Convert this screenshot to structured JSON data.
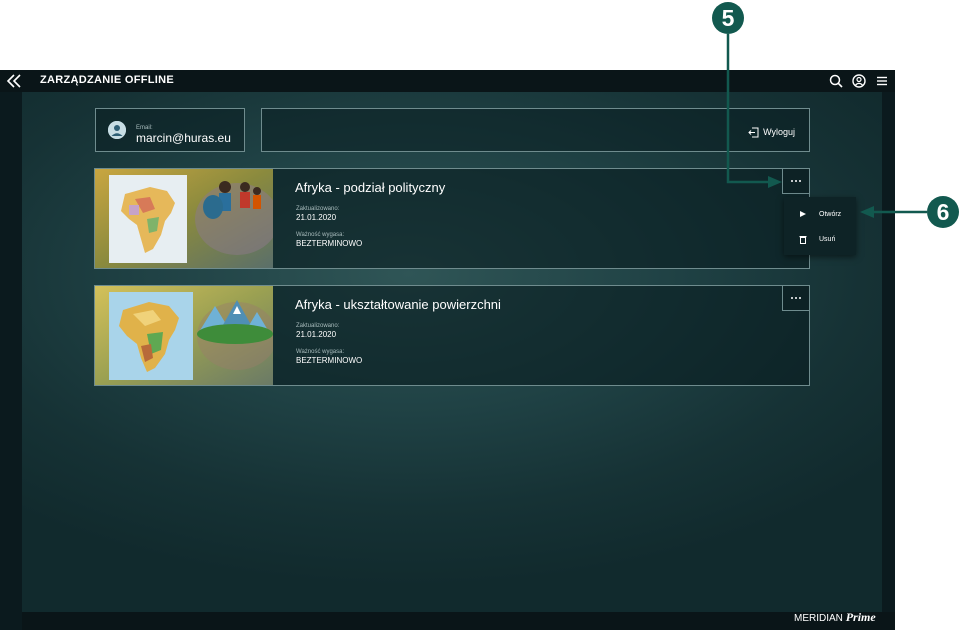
{
  "header": {
    "title": "ZARZĄDZANIE OFFLINE",
    "icons": [
      "back-icon",
      "search-icon",
      "user-icon",
      "menu-icon"
    ]
  },
  "account": {
    "email_label": "Email:",
    "email_value": "marcin@huras.eu",
    "logout_label": "Wyloguj"
  },
  "items": [
    {
      "title": "Afryka - podział polityczny",
      "updated_label": "Zaktualizowano:",
      "updated_value": "21.01.2020",
      "expiry_label": "Ważność wygasa:",
      "expiry_value": "BEZTERMINOWO"
    },
    {
      "title": "Afryka - ukształtowanie powierzchni",
      "updated_label": "Zaktualizowano:",
      "updated_value": "21.01.2020",
      "expiry_label": "Ważność wygasa:",
      "expiry_value": "BEZTERMINOWO"
    }
  ],
  "context_menu": {
    "open_label": "Otwórz",
    "delete_label": "Usuń"
  },
  "callouts": {
    "five": "5",
    "six": "6"
  },
  "footer": {
    "brand": "MERIDIAN",
    "brand_suffix": "Prime"
  },
  "colors": {
    "callout": "#12594f",
    "frame": "#0b1a1e",
    "border": "#6f8c8e"
  }
}
